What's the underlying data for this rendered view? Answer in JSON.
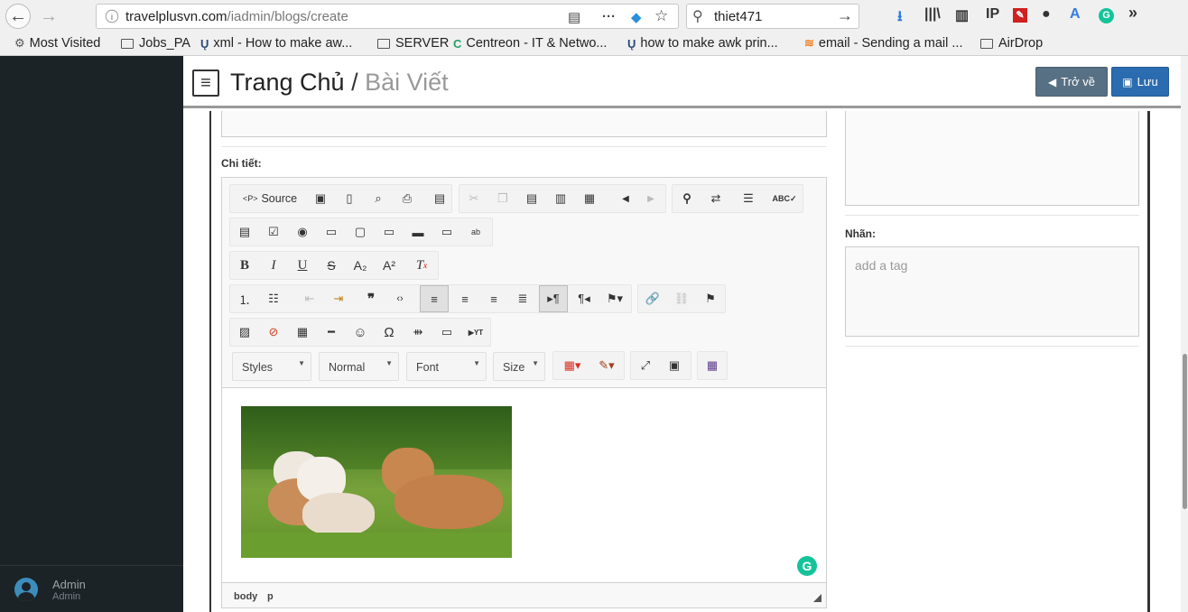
{
  "browser": {
    "url_host": "travelplusvn.com",
    "url_path": "/iadmin/blogs/create",
    "search_value": "thiet471",
    "bookmarks": [
      "Most Visited",
      "Jobs_PA",
      "xml - How to make aw...",
      "SERVER",
      "Centreon - IT & Netwo...",
      "how to make awk prin...",
      "email - Sending a mail ...",
      "AirDrop"
    ]
  },
  "header": {
    "menu_icon": "≡",
    "title_home": "Trang Chủ",
    "title_sep": "/",
    "title_current": "Bài Viết",
    "back_label": "Trở về",
    "save_label": "Lưu"
  },
  "sidebar": {
    "user_name": "Admin",
    "user_role": "Admin"
  },
  "editor": {
    "label": "Chi tiết:",
    "source_label": "Source",
    "combo_styles": "Styles",
    "combo_format": "Normal",
    "combo_font": "Font",
    "combo_size": "Size",
    "path_body": "body",
    "path_p": "p"
  },
  "right_panel": {
    "tags_label": "Nhãn:",
    "tags_placeholder": "add a tag"
  },
  "colors": {
    "sidebar_bg": "#1c2326",
    "back_btn": "#587083",
    "save_btn": "#2b6cb0",
    "grammarly": "#15c39a"
  }
}
